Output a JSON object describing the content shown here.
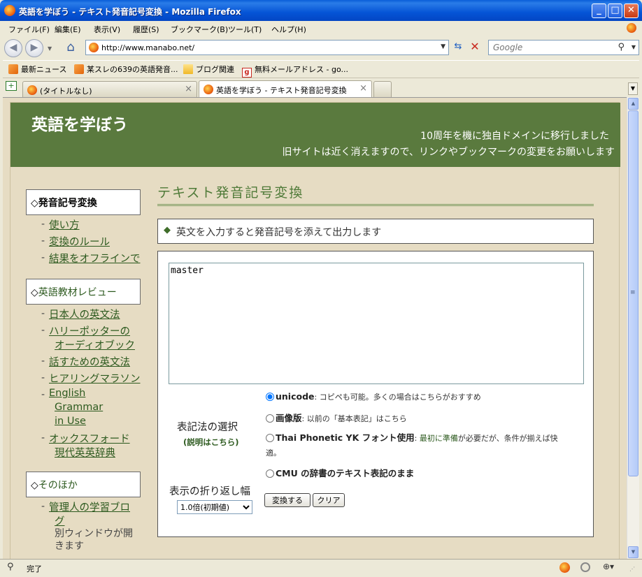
{
  "window": {
    "title": "英語を学ぼう - テキスト発音記号変換 - Mozilla Firefox"
  },
  "menu": [
    "ファイル(F)",
    "編集(E)",
    "表示(V)",
    "履歴(S)",
    "ブックマーク(B)",
    "ツール(T)",
    "ヘルプ(H)"
  ],
  "nav": {
    "url": "http://www.manabo.net/",
    "search_placeholder": "Google"
  },
  "bookmarks": [
    {
      "label": "最新ニュース",
      "icon": "rss-icon"
    },
    {
      "label": "某スレの639の英語発音...",
      "icon": "rss-icon"
    },
    {
      "label": "ブログ関連",
      "icon": "folder-icon"
    },
    {
      "label": "無料メールアドレス - go...",
      "icon": "gmail-icon"
    }
  ],
  "tabs": [
    {
      "label": "(タイトルなし)",
      "active": false
    },
    {
      "label": "英語を学ぼう - テキスト発音記号変換",
      "active": true
    }
  ],
  "page": {
    "site_title": "英語を学ぼう",
    "notice_line1": "10周年を機に独自ドメインに移行しました",
    "notice_line2": "旧サイトは近く消えますので、リンクやブックマークの変更をお願いします"
  },
  "sidebar": {
    "section1_title": "◇発音記号変換",
    "section1_links": [
      "使い方",
      "変換のルール",
      "結果をオフラインで"
    ],
    "section2_title": "英語教材レビュー",
    "section2_prefix": "◇",
    "section2_links": [
      "日本人の英文法",
      "ハリーポッターの",
      "オーディオブック",
      "話すための英文法",
      "ヒアリングマラソン",
      "English",
      "Grammar",
      "in Use",
      "オックスフォード",
      "現代英英辞典"
    ],
    "section3_title": "そのほか",
    "section3_prefix": "◇",
    "section3_link1": "管理人の学習ブロ",
    "section3_link1_cont": "グ",
    "section3_note1": "別ウィンドウが開",
    "section3_note2": "きます",
    "dash": "-"
  },
  "main": {
    "title": "テキスト発音記号変換",
    "info": "英文を入力すると発音記号を添えて出力します",
    "textarea_value": "master",
    "notation_label": "表記法の選択",
    "notation_help": "(説明はこちら)",
    "options": [
      {
        "name": "unicode",
        "desc": ": コピペも可能。多くの場合はこちらがおすすめ",
        "checked": true
      },
      {
        "name": "画像版",
        "desc": ": 以前の「基本表記」はこちら",
        "checked": false
      },
      {
        "name": "Thai Phonetic YK フォント使用",
        "desc_link": "最初に準備",
        "desc_after": "が必要だが、条件が揃えば快",
        "desc_wrap": "適。",
        "checked": false
      },
      {
        "name": "CMU の辞書のテキスト表記のまま",
        "checked": false
      }
    ],
    "wrap_label": "表示の折り返し幅",
    "wrap_value": "1.0倍(初期値)",
    "convert_button": "変換する",
    "clear_button": "クリア"
  },
  "status": {
    "text": "完了"
  }
}
